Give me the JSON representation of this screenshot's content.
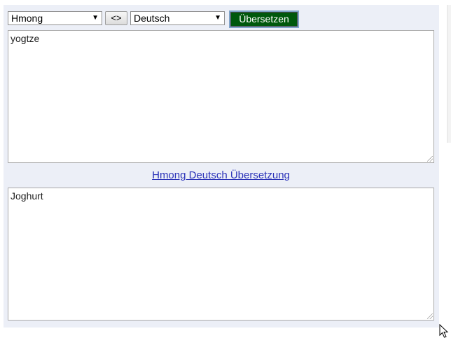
{
  "toolbar": {
    "source_language": "Hmong",
    "swap_label": "<>",
    "target_language": "Deutsch",
    "translate_label": "Übersetzen"
  },
  "source_box": {
    "value": "yogtze"
  },
  "link": {
    "text": "Hmong Deutsch Übersetzung"
  },
  "target_box": {
    "value": "Joghurt"
  },
  "icons": {
    "dropdown": "chevron-down-icon",
    "cursor": "mouse-pointer-icon"
  },
  "colors": {
    "panel_background": "#eceff7",
    "translate_button": "#00580c",
    "link": "#2a32b8"
  }
}
